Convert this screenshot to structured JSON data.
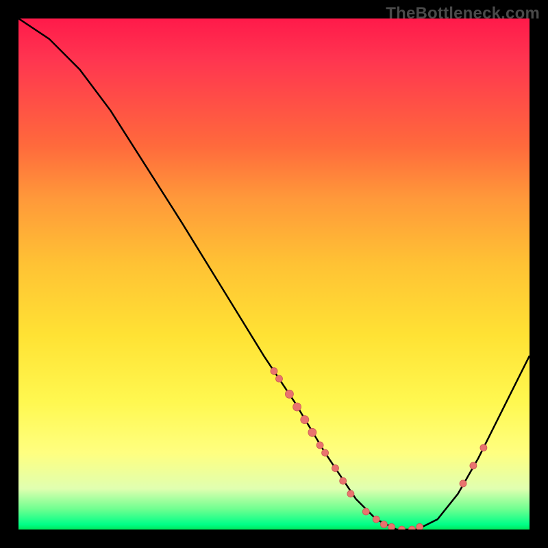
{
  "watermark": "TheBottleneck.com",
  "colors": {
    "curve": "#000000",
    "marker_fill": "#e9736e",
    "marker_stroke": "#c95a54"
  },
  "chart_data": {
    "type": "line",
    "title": "",
    "xlabel": "",
    "ylabel": "",
    "xlim": [
      0,
      100
    ],
    "ylim": [
      0,
      100
    ],
    "curve": [
      {
        "x": 0,
        "y": 100
      },
      {
        "x": 6,
        "y": 96
      },
      {
        "x": 12,
        "y": 90
      },
      {
        "x": 18,
        "y": 82
      },
      {
        "x": 25,
        "y": 71
      },
      {
        "x": 32,
        "y": 60
      },
      {
        "x": 40,
        "y": 47
      },
      {
        "x": 48,
        "y": 34
      },
      {
        "x": 54,
        "y": 25
      },
      {
        "x": 60,
        "y": 15
      },
      {
        "x": 66,
        "y": 6
      },
      {
        "x": 70,
        "y": 2
      },
      {
        "x": 74,
        "y": 0
      },
      {
        "x": 78,
        "y": 0
      },
      {
        "x": 82,
        "y": 2
      },
      {
        "x": 86,
        "y": 7
      },
      {
        "x": 90,
        "y": 14
      },
      {
        "x": 94,
        "y": 22
      },
      {
        "x": 98,
        "y": 30
      },
      {
        "x": 100,
        "y": 34
      }
    ],
    "markers": [
      {
        "x": 50,
        "y": 31,
        "r": 5
      },
      {
        "x": 51,
        "y": 29.5,
        "r": 5
      },
      {
        "x": 53,
        "y": 26.5,
        "r": 6
      },
      {
        "x": 54.5,
        "y": 24,
        "r": 6
      },
      {
        "x": 56,
        "y": 21.5,
        "r": 6
      },
      {
        "x": 57.5,
        "y": 19,
        "r": 6
      },
      {
        "x": 59,
        "y": 16.5,
        "r": 5
      },
      {
        "x": 60,
        "y": 15,
        "r": 5
      },
      {
        "x": 62,
        "y": 12,
        "r": 5
      },
      {
        "x": 63.5,
        "y": 9.5,
        "r": 5
      },
      {
        "x": 65,
        "y": 7,
        "r": 5
      },
      {
        "x": 68,
        "y": 3.5,
        "r": 5
      },
      {
        "x": 70,
        "y": 2,
        "r": 5
      },
      {
        "x": 71.5,
        "y": 1,
        "r": 5
      },
      {
        "x": 73,
        "y": 0.5,
        "r": 5
      },
      {
        "x": 75,
        "y": 0,
        "r": 5
      },
      {
        "x": 77,
        "y": 0,
        "r": 5
      },
      {
        "x": 78.5,
        "y": 0.5,
        "r": 5
      },
      {
        "x": 87,
        "y": 9,
        "r": 5
      },
      {
        "x": 89,
        "y": 12.5,
        "r": 5
      },
      {
        "x": 91,
        "y": 16,
        "r": 5
      }
    ]
  }
}
